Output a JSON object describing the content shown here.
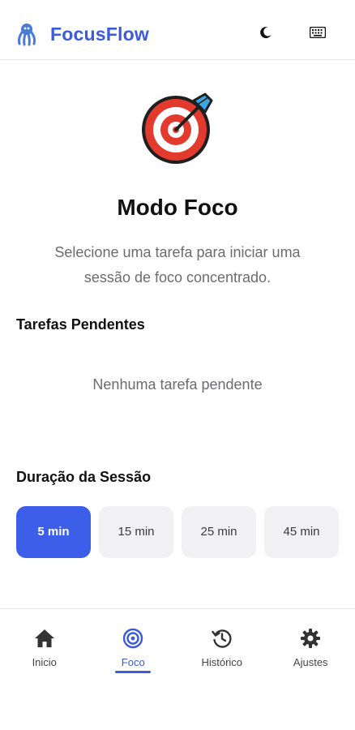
{
  "header": {
    "app_title": "FocusFlow",
    "logo_icon": "octopus-icon",
    "theme_icon": "moon-icon",
    "keyboard_icon": "keyboard-icon"
  },
  "main": {
    "hero_icon": "target-dart-icon",
    "title": "Modo Foco",
    "subtitle": "Selecione uma tarefa para iniciar uma sessão de foco concentrado.",
    "tasks_section_label": "Tarefas Pendentes",
    "tasks_empty_text": "Nenhuma tarefa pendente",
    "duration_section_label": "Duração da Sessão",
    "durations": [
      {
        "label": "5 min",
        "selected": true
      },
      {
        "label": "15 min",
        "selected": false
      },
      {
        "label": "25 min",
        "selected": false
      },
      {
        "label": "45 min",
        "selected": false
      }
    ]
  },
  "tabbar": {
    "items": [
      {
        "label": "Inicio",
        "icon": "home-icon",
        "active": false
      },
      {
        "label": "Foco",
        "icon": "focus-target-icon",
        "active": true
      },
      {
        "label": "Histórico",
        "icon": "history-icon",
        "active": false
      },
      {
        "label": "Ajustes",
        "icon": "gear-icon",
        "active": false
      }
    ]
  },
  "colors": {
    "accent": "#3b5bdb",
    "selected_button": "#3d5ee8",
    "muted_text": "#6b6b70"
  }
}
